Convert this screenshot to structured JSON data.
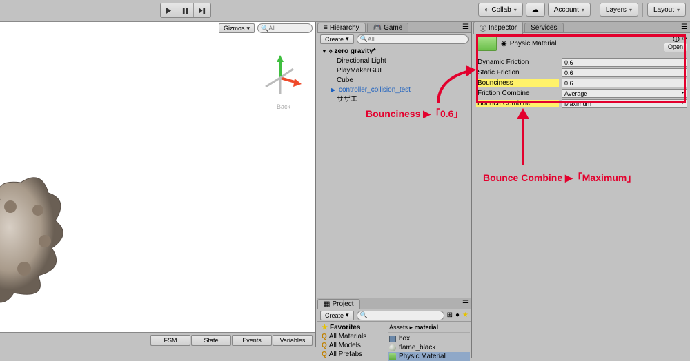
{
  "topbar": {
    "collab": "Collab",
    "account": "Account",
    "layers": "Layers",
    "layout": "Layout"
  },
  "scene": {
    "gizmos_label": "Gizmos",
    "search_placeholder": "All",
    "back_label": "Back",
    "footer": {
      "fsm": "FSM",
      "state": "State",
      "events": "Events",
      "variables": "Variables"
    }
  },
  "hierarchy": {
    "tab": "Hierarchy",
    "tab2": "Game",
    "create": "Create",
    "search_placeholder": "All",
    "root": "zero gravity*",
    "items": [
      "Directional Light",
      "PlayMakerGUI",
      "Cube",
      "controller_collision_test",
      "サザエ"
    ]
  },
  "project": {
    "tab": "Project",
    "create": "Create",
    "favorites": "Favorites",
    "fav_items": [
      "All Materials",
      "All Models",
      "All Prefabs"
    ],
    "crumb1": "Assets",
    "crumb2": "material",
    "assets": [
      "box",
      "flame_black",
      "Physic Material"
    ]
  },
  "inspector": {
    "tab": "Inspector",
    "tab2": "Services",
    "title": "Physic Material",
    "open": "Open",
    "props": {
      "dynamic_friction": {
        "label": "Dynamic Friction",
        "value": "0.6"
      },
      "static_friction": {
        "label": "Static Friction",
        "value": "0.6"
      },
      "bounciness": {
        "label": "Bounciness",
        "value": "0.6"
      },
      "friction_combine": {
        "label": "Friction Combine",
        "value": "Average"
      },
      "bounce_combine": {
        "label": "Bounce Combine",
        "value": "Maximum"
      }
    }
  },
  "annotations": {
    "a1": "Bounciness ▶「0.6」",
    "a2": "Bounce Combine ▶「Maximum」"
  }
}
